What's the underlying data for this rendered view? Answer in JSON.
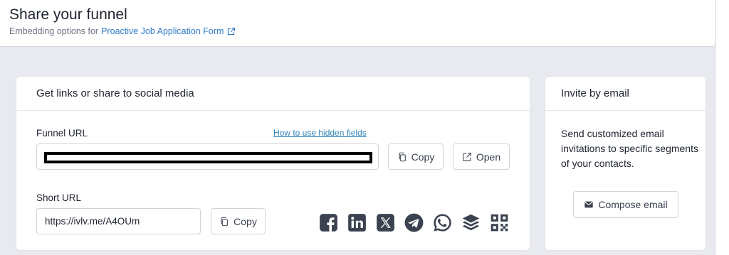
{
  "header": {
    "title": "Share your funnel",
    "subtitle_prefix": "Embedding options for",
    "form_link": "Proactive Job Application Form"
  },
  "share_card": {
    "heading": "Get links or share to social media",
    "funnel_url_label": "Funnel URL",
    "hidden_fields_link": "How to use hidden fields",
    "funnel_url_value": "",
    "copy_label": "Copy",
    "open_label": "Open",
    "short_url_label": "Short URL",
    "short_url_value": "https://ivlv.me/A4OUm",
    "short_copy_label": "Copy",
    "social_icons": [
      "facebook-icon",
      "linkedin-icon",
      "x-icon",
      "telegram-icon",
      "whatsapp-icon",
      "buffer-icon",
      "qr-code-icon"
    ]
  },
  "invite_card": {
    "heading": "Invite by email",
    "description": "Send customized email invitations to specific segments of your contacts.",
    "compose_label": "Compose email"
  },
  "colors": {
    "link": "#2f7bc4",
    "icon": "#3b4250",
    "background": "#e8eaf0"
  }
}
